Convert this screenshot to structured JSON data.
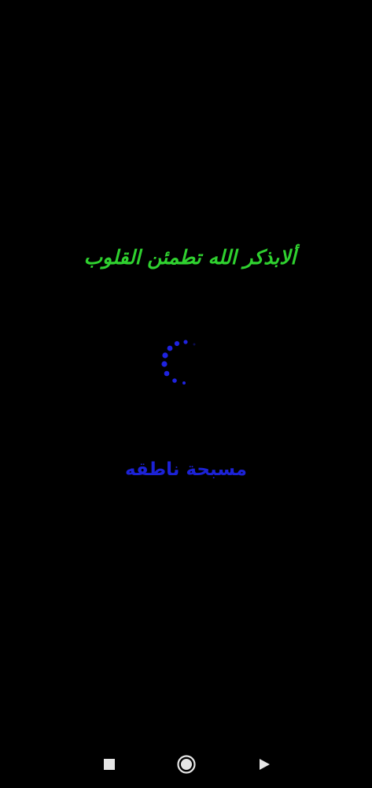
{
  "splash": {
    "tagline": "ألابذكر الله تطمئن القلوب",
    "app_name": "مسبحة ناطقه"
  },
  "loading_indicator": {
    "icon": "loading-spinner-icon"
  },
  "navigation_bar": {
    "recents_icon": "square-recents-icon",
    "home_icon": "circle-home-icon",
    "back_icon": "triangle-back-icon"
  },
  "colors": {
    "background": "#000000",
    "tagline": "#2fd12f",
    "app_name": "#1c22d6",
    "spinner": "#1f23e0",
    "nav_icons": "#e6e6e6"
  }
}
